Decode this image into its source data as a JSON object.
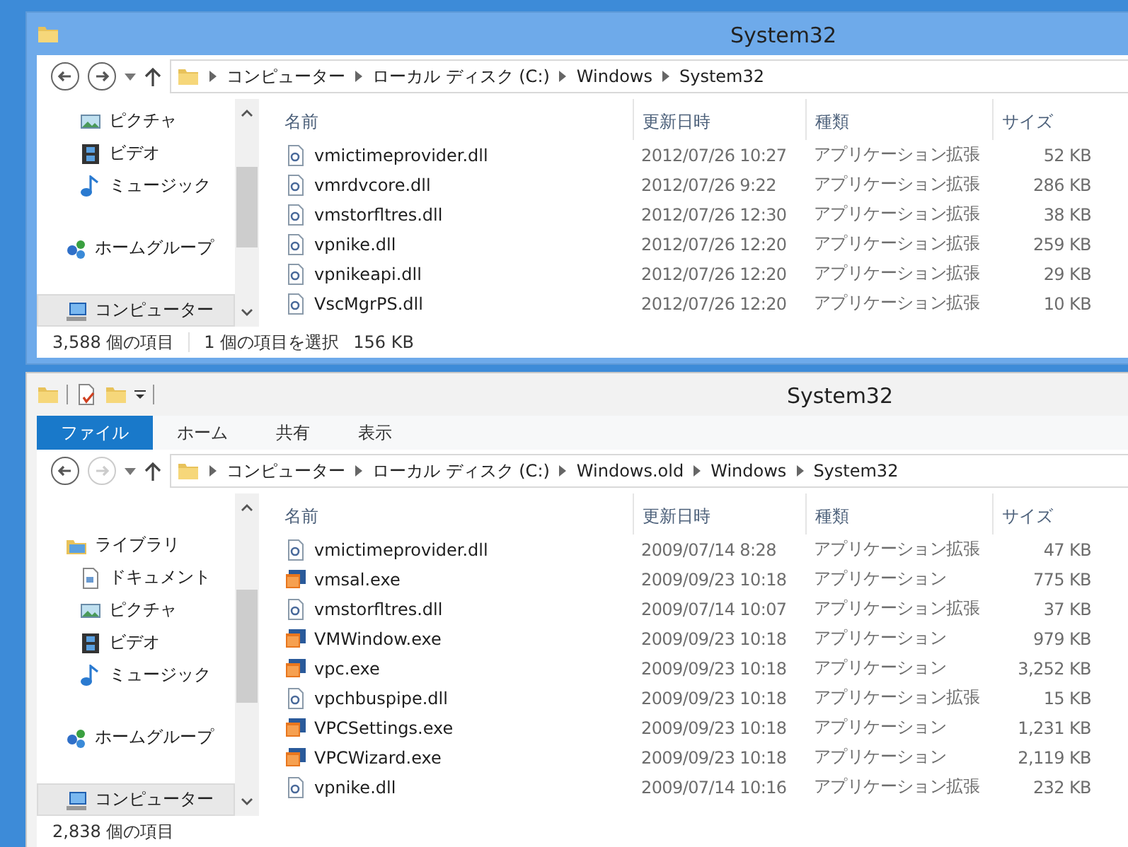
{
  "windows": [
    {
      "title": "System32",
      "active": true,
      "quick_access_toolbar": false,
      "forward_enabled": true,
      "address": [
        "コンピューター",
        "ローカル ディスク (C:)",
        "Windows",
        "System32"
      ],
      "nav": [
        {
          "children": [
            {
              "label": "ピクチャ",
              "kind": "pictures",
              "selected": false
            },
            {
              "label": "ビデオ",
              "kind": "videos",
              "selected": false
            },
            {
              "label": "ミュージック",
              "kind": "music",
              "selected": false
            }
          ]
        },
        {
          "label": "ホームグループ",
          "kind": "homegroup",
          "selected": false
        },
        {
          "label": "コンピューター",
          "kind": "computer",
          "selected": true
        }
      ],
      "columns": [
        "名前",
        "更新日時",
        "種類",
        "サイズ"
      ],
      "rows": [
        {
          "name": "vmictimeprovider.dll",
          "kind": "dll",
          "modified": "2012/07/26 10:27",
          "type": "アプリケーション拡張",
          "size": "52 KB"
        },
        {
          "name": "vmrdvcore.dll",
          "kind": "dll",
          "modified": "2012/07/26 9:22",
          "type": "アプリケーション拡張",
          "size": "286 KB"
        },
        {
          "name": "vmstorfltres.dll",
          "kind": "dll",
          "modified": "2012/07/26 12:30",
          "type": "アプリケーション拡張",
          "size": "38 KB"
        },
        {
          "name": "vpnike.dll",
          "kind": "dll",
          "modified": "2012/07/26 12:20",
          "type": "アプリケーション拡張",
          "size": "259 KB"
        },
        {
          "name": "vpnikeapi.dll",
          "kind": "dll",
          "modified": "2012/07/26 12:20",
          "type": "アプリケーション拡張",
          "size": "29 KB"
        },
        {
          "name": "VscMgrPS.dll",
          "kind": "dll",
          "modified": "2012/07/26 12:20",
          "type": "アプリケーション拡張",
          "size": "10 KB"
        }
      ],
      "status": {
        "count": "3,588 個の項目",
        "selection": "1 個の項目を選択",
        "selection_size": "156 KB"
      }
    },
    {
      "title": "System32",
      "active": false,
      "quick_access_toolbar": true,
      "forward_enabled": false,
      "ribbon_tabs": [
        {
          "label": "ファイル",
          "selected": true
        },
        {
          "label": "ホーム",
          "selected": false
        },
        {
          "label": "共有",
          "selected": false
        },
        {
          "label": "表示",
          "selected": false
        }
      ],
      "address": [
        "コンピューター",
        "ローカル ディスク (C:)",
        "Windows.old",
        "Windows",
        "System32"
      ],
      "nav": [
        {
          "label": "ライブラリ",
          "kind": "library",
          "selected": false,
          "children": [
            {
              "label": "ドキュメント",
              "kind": "documents",
              "selected": false
            },
            {
              "label": "ピクチャ",
              "kind": "pictures",
              "selected": false
            },
            {
              "label": "ビデオ",
              "kind": "videos",
              "selected": false
            },
            {
              "label": "ミュージック",
              "kind": "music",
              "selected": false
            }
          ]
        },
        {
          "label": "ホームグループ",
          "kind": "homegroup",
          "selected": false
        },
        {
          "label": "コンピューター",
          "kind": "computer",
          "selected": true
        }
      ],
      "columns": [
        "名前",
        "更新日時",
        "種類",
        "サイズ"
      ],
      "rows": [
        {
          "name": "vmictimeprovider.dll",
          "kind": "dll",
          "modified": "2009/07/14 8:28",
          "type": "アプリケーション拡張",
          "size": "47 KB"
        },
        {
          "name": "vmsal.exe",
          "kind": "exe",
          "modified": "2009/09/23 10:18",
          "type": "アプリケーション",
          "size": "775 KB"
        },
        {
          "name": "vmstorfltres.dll",
          "kind": "dll",
          "modified": "2009/07/14 10:07",
          "type": "アプリケーション拡張",
          "size": "37 KB"
        },
        {
          "name": "VMWindow.exe",
          "kind": "exe",
          "modified": "2009/09/23 10:18",
          "type": "アプリケーション",
          "size": "979 KB"
        },
        {
          "name": "vpc.exe",
          "kind": "exe",
          "modified": "2009/09/23 10:18",
          "type": "アプリケーション",
          "size": "3,252 KB"
        },
        {
          "name": "vpchbuspipe.dll",
          "kind": "dll",
          "modified": "2009/09/23 10:18",
          "type": "アプリケーション拡張",
          "size": "15 KB"
        },
        {
          "name": "VPCSettings.exe",
          "kind": "exe",
          "modified": "2009/09/23 10:18",
          "type": "アプリケーション",
          "size": "1,231 KB"
        },
        {
          "name": "VPCWizard.exe",
          "kind": "exe",
          "modified": "2009/09/23 10:18",
          "type": "アプリケーション",
          "size": "2,119 KB"
        },
        {
          "name": "vpnike.dll",
          "kind": "dll",
          "modified": "2009/07/14 10:16",
          "type": "アプリケーション拡張",
          "size": "232 KB"
        }
      ],
      "status": {
        "count": "2,838 個の項目"
      }
    }
  ]
}
